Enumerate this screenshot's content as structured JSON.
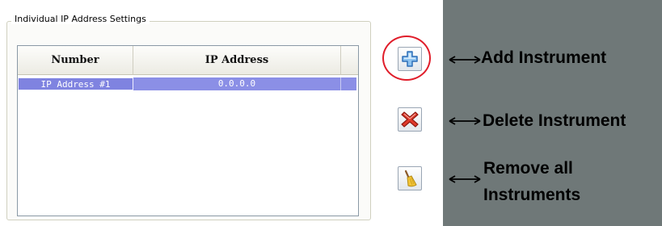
{
  "group": {
    "title": "Individual IP Address Settings"
  },
  "table": {
    "columns": [
      "Number",
      "IP Address"
    ],
    "rows": [
      {
        "number": "IP Address #1",
        "ip": "0.0.0.0",
        "selected": true
      }
    ]
  },
  "buttons": {
    "add": {
      "icon": "plus-icon"
    },
    "delete": {
      "icon": "red-x-icon"
    },
    "remove_all": {
      "icon": "broom-icon"
    }
  },
  "annotations": {
    "add": "Add Instrument",
    "delete": "Delete Instrument",
    "remove_all_line1": "Remove all",
    "remove_all_line2": "Instruments"
  },
  "colors": {
    "panel_background": "#6f7878",
    "selection": "#8b8fe6",
    "highlight_circle": "#e01d2a"
  }
}
